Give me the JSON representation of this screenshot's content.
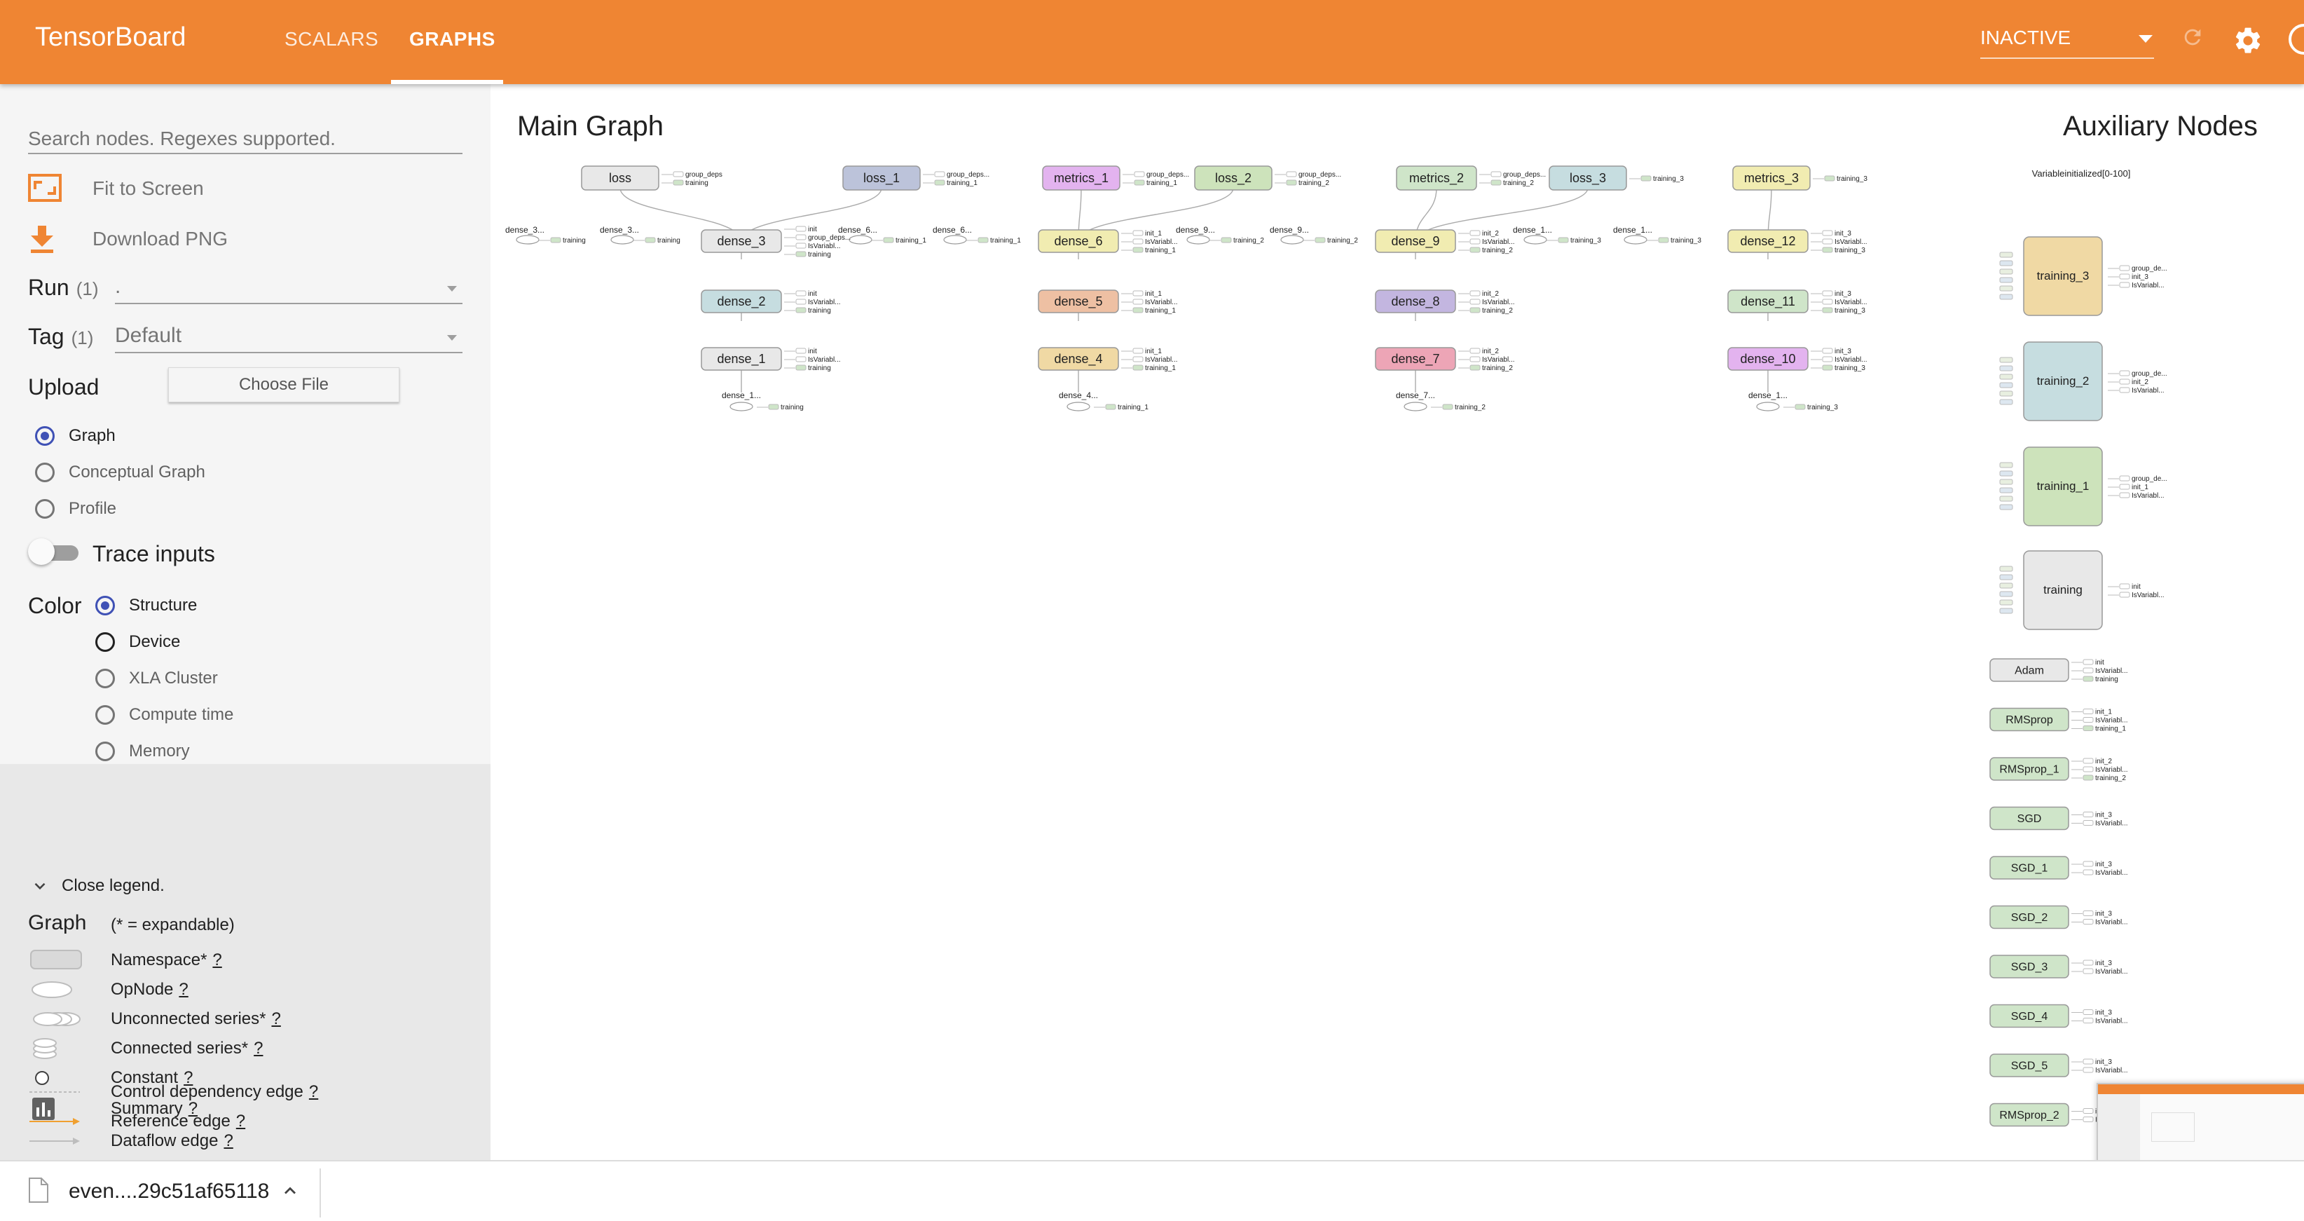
{
  "header": {
    "title": "TensorBoard",
    "tabs": [
      {
        "label": "SCALARS",
        "active": false
      },
      {
        "label": "GRAPHS",
        "active": true
      }
    ],
    "run_status": "INACTIVE"
  },
  "sidebar": {
    "search_placeholder": "Search nodes. Regexes supported.",
    "fit_to_screen": "Fit to Screen",
    "download_png": "Download PNG",
    "run": {
      "label": "Run",
      "count": "(1)",
      "value": "."
    },
    "tag": {
      "label": "Tag",
      "count": "(1)",
      "value": "Default"
    },
    "upload": {
      "label": "Upload",
      "button": "Choose File"
    },
    "graph_modes": [
      {
        "label": "Graph",
        "selected": true
      },
      {
        "label": "Conceptual Graph",
        "selected": false
      },
      {
        "label": "Profile",
        "selected": false
      }
    ],
    "trace_inputs": {
      "label": "Trace inputs",
      "on": false
    },
    "color": {
      "label": "Color",
      "options": [
        {
          "label": "Structure",
          "selected": true
        },
        {
          "label": "Device",
          "selected": false
        },
        {
          "label": "XLA Cluster",
          "selected": false
        },
        {
          "label": "Compute time",
          "selected": false
        },
        {
          "label": "Memory",
          "selected": false
        }
      ]
    }
  },
  "legend": {
    "close_label": "Close legend.",
    "title": "Graph",
    "subtitle": "(* = expandable)",
    "items": [
      {
        "label": "Namespace*",
        "help": "?"
      },
      {
        "label": "OpNode",
        "help": "?"
      },
      {
        "label": "Unconnected series*",
        "help": "?"
      },
      {
        "label": "Connected series*",
        "help": "?"
      },
      {
        "label": "Constant",
        "help": "?"
      },
      {
        "label": "Summary",
        "help": "?"
      },
      {
        "label": "Dataflow edge",
        "help": "?"
      },
      {
        "label": "Control dependency edge",
        "help": "?"
      },
      {
        "label": "Reference edge",
        "help": "?"
      }
    ]
  },
  "graph": {
    "main_title": "Main Graph",
    "aux_title": "Auxiliary Nodes",
    "top_nodes": [
      {
        "label": "loss",
        "color": "#e8e8e8",
        "side": [
          "group_deps",
          "training"
        ]
      },
      {
        "label": "loss_1",
        "color": "#bcc3da",
        "side": [
          "group_deps...",
          "training_1"
        ]
      },
      {
        "label": "metrics_1",
        "color": "#e3b3ef",
        "side": [
          "group_deps...",
          "training_1"
        ]
      },
      {
        "label": "loss_2",
        "color": "#cde3bb",
        "side": [
          "group_deps...",
          "training_2"
        ]
      },
      {
        "label": "metrics_2",
        "color": "#cfe5c9",
        "side": [
          "group_deps...",
          "training_2"
        ]
      },
      {
        "label": "loss_3",
        "color": "#c6dde0",
        "side": [
          "training_3"
        ]
      },
      {
        "label": "metrics_3",
        "color": "#f1ecb1",
        "side": [
          "training_3"
        ]
      }
    ],
    "columns": [
      {
        "nodes": [
          {
            "label": "dense_3",
            "color": "#e8e8e8",
            "side": [
              "init",
              "group_deps...",
              "IsVariabl...",
              "training"
            ]
          },
          {
            "label": "dense_2",
            "color": "#c6dde0",
            "side": [
              "init",
              "IsVariabl...",
              "training"
            ]
          },
          {
            "label": "dense_1",
            "color": "#e8e8e8",
            "side": [
              "init",
              "IsVariabl...",
              "training"
            ]
          }
        ],
        "bottom": "dense_1...",
        "bottom_side": "training"
      },
      {
        "nodes": [
          {
            "label": "dense_6",
            "color": "#f1ecb1",
            "side": [
              "init_1",
              "IsVariabl...",
              "training_1"
            ]
          },
          {
            "label": "dense_5",
            "color": "#eec0a3",
            "side": [
              "init_1",
              "IsVariabl...",
              "training_1"
            ]
          },
          {
            "label": "dense_4",
            "color": "#f0d9a4",
            "side": [
              "init_1",
              "IsVariabl...",
              "training_1"
            ]
          }
        ],
        "bottom": "dense_4...",
        "bottom_side": "training_1"
      },
      {
        "nodes": [
          {
            "label": "dense_9",
            "color": "#f1ecb1",
            "side": [
              "init_2",
              "IsVariabl...",
              "training_2"
            ]
          },
          {
            "label": "dense_8",
            "color": "#c3b6e0",
            "side": [
              "init_2",
              "IsVariabl...",
              "training_2"
            ]
          },
          {
            "label": "dense_7",
            "color": "#eda5b6",
            "side": [
              "init_2",
              "IsVariabl...",
              "training_2"
            ]
          }
        ],
        "bottom": "dense_7...",
        "bottom_side": "training_2"
      },
      {
        "nodes": [
          {
            "label": "dense_12",
            "color": "#f1ecb1",
            "side": [
              "init_3",
              "IsVariabl...",
              "training_3"
            ]
          },
          {
            "label": "dense_11",
            "color": "#cfe5c9",
            "side": [
              "init_3",
              "IsVariabl...",
              "training_3"
            ]
          },
          {
            "label": "dense_10",
            "color": "#e3b3ef",
            "side": [
              "init_3",
              "IsVariabl...",
              "training_3"
            ]
          }
        ],
        "bottom": "dense_1...",
        "bottom_side": "training_3"
      }
    ],
    "row2_labels": [
      "dense_3...",
      "dense_3...",
      "dense_6...",
      "dense_6...",
      "dense_9...",
      "dense_9...",
      "dense_1...",
      "dense_1..."
    ],
    "row2_sides": [
      "training",
      "training",
      "training_1",
      "training_1",
      "training_2",
      "training_2",
      "training_3",
      "training_3"
    ],
    "aux_large": [
      {
        "label": "training_3",
        "color": "#f0d9a4",
        "side": [
          "group_de...",
          "init_3",
          "IsVariabl..."
        ]
      },
      {
        "label": "training_2",
        "color": "#c6dde0",
        "side": [
          "group_de...",
          "init_2",
          "IsVariabl..."
        ]
      },
      {
        "label": "training_1",
        "color": "#cde3bb",
        "side": [
          "group_de...",
          "init_1",
          "IsVariabl..."
        ]
      },
      {
        "label": "training",
        "color": "#e8e8e8",
        "side": [
          "init",
          "IsVariabl..."
        ]
      }
    ],
    "aux_top_label": "Variableinitialized[0-100]",
    "aux_small": [
      {
        "label": "Adam",
        "color": "#e8e8e8",
        "side": [
          "init",
          "IsVariabl...",
          "training"
        ]
      },
      {
        "label": "RMSprop",
        "color": "#cfe5c9",
        "side": [
          "init_1",
          "IsVariabl...",
          "training_1"
        ]
      },
      {
        "label": "RMSprop_1",
        "color": "#cfe5c9",
        "side": [
          "init_2",
          "IsVariabl...",
          "training_2"
        ]
      },
      {
        "label": "SGD",
        "color": "#cfe5c9",
        "side": [
          "init_3",
          "IsVariabl..."
        ]
      },
      {
        "label": "SGD_1",
        "color": "#cfe5c9",
        "side": [
          "init_3",
          "IsVariabl..."
        ]
      },
      {
        "label": "SGD_2",
        "color": "#cfe5c9",
        "side": [
          "init_3",
          "IsVariabl..."
        ]
      },
      {
        "label": "SGD_3",
        "color": "#cfe5c9",
        "side": [
          "init_3",
          "IsVariabl..."
        ]
      },
      {
        "label": "SGD_4",
        "color": "#cfe5c9",
        "side": [
          "init_3",
          "IsVariabl..."
        ]
      },
      {
        "label": "SGD_5",
        "color": "#cfe5c9",
        "side": [
          "init_3",
          "IsVariabl..."
        ]
      },
      {
        "label": "RMSprop_2",
        "color": "#cfe5c9",
        "side": [
          "init_3",
          "IsVariabl..."
        ]
      }
    ]
  },
  "download_bar": {
    "file_name": "even....29c51af65118"
  },
  "icons": {
    "fit": "fit-screen-icon",
    "download": "download-icon",
    "settings": "gear-icon",
    "reload": "reload-icon",
    "help": "help-icon",
    "file": "file-icon"
  }
}
